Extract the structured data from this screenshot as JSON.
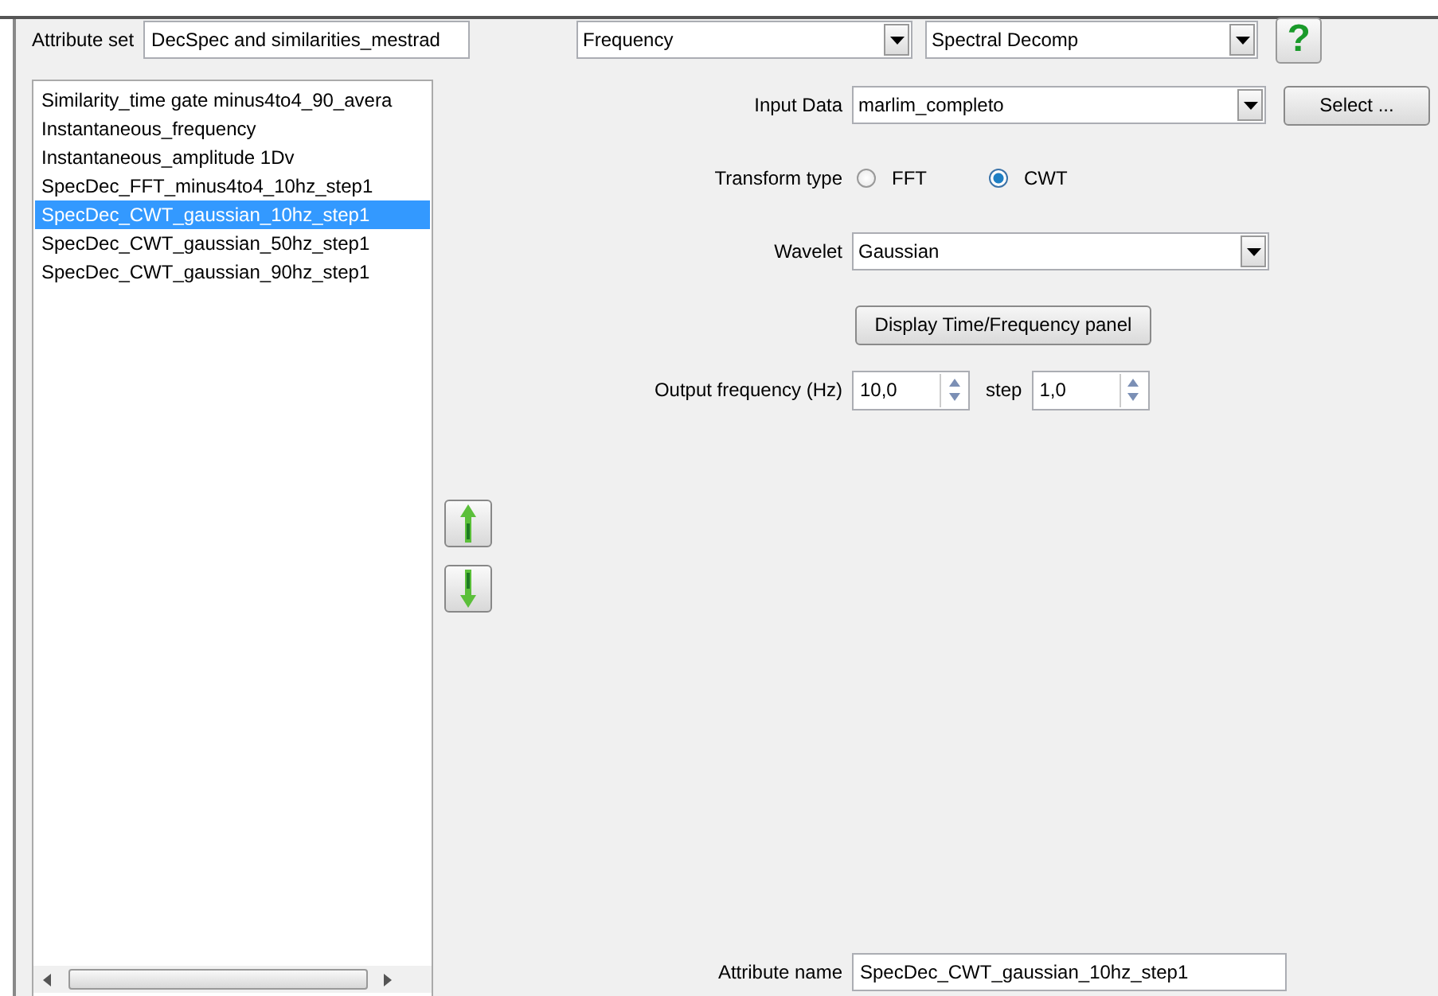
{
  "attribute_set": {
    "label": "Attribute set",
    "value": "DecSpec and similarities_mestrad"
  },
  "category": {
    "value": "Frequency"
  },
  "method": {
    "value": "Spectral Decomp"
  },
  "help_button": {
    "label": "?"
  },
  "attributes": [
    {
      "label": "Similarity_time gate minus4to4_90_avera",
      "selected": false
    },
    {
      "label": "Instantaneous_frequency",
      "selected": false
    },
    {
      "label": "Instantaneous_amplitude 1Dv",
      "selected": false
    },
    {
      "label": "SpecDec_FFT_minus4to4_10hz_step1",
      "selected": false
    },
    {
      "label": "SpecDec_CWT_gaussian_10hz_step1",
      "selected": true
    },
    {
      "label": "SpecDec_CWT_gaussian_50hz_step1",
      "selected": false
    },
    {
      "label": "SpecDec_CWT_gaussian_90hz_step1",
      "selected": false
    }
  ],
  "input_data": {
    "label": "Input Data",
    "value": "marlim_completo"
  },
  "select_button": {
    "label": "Select ..."
  },
  "transform_type": {
    "label": "Transform type",
    "options": [
      {
        "label": "FFT",
        "selected": false
      },
      {
        "label": "CWT",
        "selected": true
      }
    ]
  },
  "wavelet": {
    "label": "Wavelet",
    "value": "Gaussian"
  },
  "display_button": {
    "label": "Display Time/Frequency panel"
  },
  "output_frequency": {
    "label": "Output frequency (Hz)",
    "value": "10,0"
  },
  "step": {
    "label": "step",
    "value": "1,0"
  },
  "attribute_name": {
    "label": "Attribute name",
    "value": "SpecDec_CWT_gaussian_10hz_step1"
  }
}
